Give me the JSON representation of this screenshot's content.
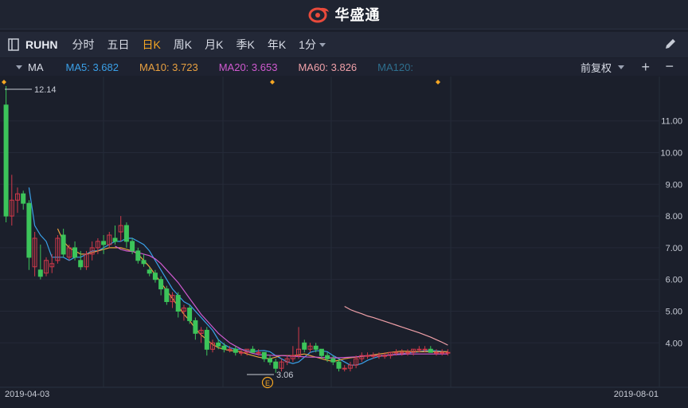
{
  "app": {
    "brand": "华盛通"
  },
  "toolbar": {
    "symbol": "RUHN",
    "periods": [
      "分时",
      "五日",
      "日K",
      "周K",
      "月K",
      "季K",
      "年K"
    ],
    "active_period": "日K",
    "minute_select": "1分"
  },
  "ma_legend": {
    "name": "MA",
    "items": [
      {
        "label": "MA5: 3.682",
        "color": "#3aa0e8"
      },
      {
        "label": "MA10: 3.723",
        "color": "#e8a040"
      },
      {
        "label": "MA20: 3.653",
        "color": "#d05ad0"
      },
      {
        "label": "MA60: 3.826",
        "color": "#f0a0a8"
      },
      {
        "label": "MA120:",
        "color": "#2e6f8e"
      }
    ],
    "adjust": "前复权"
  },
  "colors": {
    "up": "#d0394a",
    "down": "#3cc45a",
    "grid": "#2a3040",
    "bg": "#1b1f2b"
  },
  "chart_data": {
    "type": "candlestick",
    "x_start_label": "2019-04-03",
    "x_end_label": "2019-08-01",
    "ylim": [
      2.6,
      12.4
    ],
    "yticks": [
      "11.00",
      "10.00",
      "9.00",
      "8.00",
      "7.00",
      "6.00",
      "5.00",
      "4.00"
    ],
    "high_label": "12.14",
    "low_label": "3.06",
    "event_badge": "E",
    "ohlc": [
      [
        11.5,
        12.1,
        7.8,
        8.0
      ],
      [
        8.0,
        9.3,
        7.7,
        8.5
      ],
      [
        8.5,
        8.9,
        8.1,
        8.7
      ],
      [
        8.7,
        8.8,
        8.2,
        8.4
      ],
      [
        8.4,
        8.5,
        6.3,
        6.7
      ],
      [
        6.4,
        7.5,
        6.1,
        7.3
      ],
      [
        6.3,
        7.1,
        6.0,
        6.1
      ],
      [
        6.2,
        6.7,
        6.1,
        6.6
      ],
      [
        6.4,
        6.8,
        6.2,
        6.5
      ],
      [
        6.6,
        7.4,
        6.5,
        7.3
      ],
      [
        7.4,
        7.6,
        6.7,
        6.8
      ],
      [
        6.7,
        7.1,
        6.6,
        7.0
      ],
      [
        7.0,
        7.2,
        6.6,
        6.7
      ],
      [
        6.6,
        6.9,
        6.3,
        6.4
      ],
      [
        6.4,
        6.9,
        6.3,
        6.8
      ],
      [
        6.8,
        7.2,
        6.6,
        7.0
      ],
      [
        7.0,
        7.3,
        6.8,
        7.2
      ],
      [
        7.2,
        7.4,
        6.8,
        7.1
      ],
      [
        7.1,
        7.5,
        7.0,
        7.4
      ],
      [
        7.3,
        7.7,
        7.1,
        7.2
      ],
      [
        7.5,
        8.0,
        7.2,
        7.7
      ],
      [
        7.7,
        7.8,
        7.0,
        7.2
      ],
      [
        7.2,
        7.3,
        6.8,
        6.9
      ],
      [
        6.9,
        7.0,
        6.5,
        6.6
      ],
      [
        6.6,
        6.8,
        6.4,
        6.5
      ],
      [
        6.3,
        6.4,
        6.1,
        6.2
      ],
      [
        6.2,
        6.3,
        5.9,
        6.0
      ],
      [
        6.0,
        6.1,
        5.5,
        5.7
      ],
      [
        5.7,
        5.8,
        5.2,
        5.3
      ],
      [
        5.3,
        5.6,
        5.1,
        5.5
      ],
      [
        5.5,
        5.6,
        4.8,
        5.0
      ],
      [
        5.0,
        5.2,
        4.7,
        5.1
      ],
      [
        5.1,
        5.2,
        4.6,
        4.7
      ],
      [
        4.7,
        4.8,
        4.1,
        4.3
      ],
      [
        4.3,
        4.5,
        4.0,
        4.4
      ],
      [
        4.4,
        4.5,
        3.6,
        3.8
      ],
      [
        3.8,
        4.1,
        3.7,
        4.0
      ],
      [
        4.0,
        4.1,
        3.8,
        3.9
      ],
      [
        3.9,
        4.0,
        3.7,
        3.8
      ],
      [
        3.8,
        3.9,
        3.7,
        3.8
      ],
      [
        3.8,
        3.9,
        3.6,
        3.7
      ],
      [
        3.7,
        3.8,
        3.6,
        3.7
      ],
      [
        3.7,
        3.8,
        3.6,
        3.8
      ],
      [
        3.8,
        3.9,
        3.7,
        3.7
      ],
      [
        3.7,
        3.8,
        3.6,
        3.7
      ],
      [
        3.7,
        3.7,
        3.4,
        3.5
      ],
      [
        3.5,
        3.6,
        3.3,
        3.4
      ],
      [
        3.4,
        3.5,
        3.06,
        3.2
      ],
      [
        3.2,
        3.5,
        3.1,
        3.4
      ],
      [
        3.4,
        3.6,
        3.3,
        3.5
      ],
      [
        3.5,
        3.9,
        3.4,
        3.6
      ],
      [
        3.6,
        4.5,
        3.5,
        3.8
      ],
      [
        4.0,
        4.1,
        3.7,
        3.8
      ],
      [
        3.8,
        4.0,
        3.7,
        3.9
      ],
      [
        3.9,
        4.0,
        3.7,
        3.8
      ],
      [
        3.8,
        3.8,
        3.5,
        3.6
      ],
      [
        3.6,
        3.7,
        3.4,
        3.5
      ],
      [
        3.5,
        3.6,
        3.3,
        3.4
      ],
      [
        3.4,
        3.5,
        3.1,
        3.2
      ],
      [
        3.2,
        3.3,
        3.1,
        3.2
      ],
      [
        3.2,
        3.4,
        3.1,
        3.3
      ],
      [
        3.3,
        3.6,
        3.2,
        3.5
      ],
      [
        3.5,
        3.7,
        3.4,
        3.6
      ],
      [
        3.6,
        3.7,
        3.5,
        3.6
      ],
      [
        3.6,
        3.7,
        3.5,
        3.6
      ],
      [
        3.6,
        3.7,
        3.5,
        3.6
      ],
      [
        3.6,
        3.7,
        3.5,
        3.6
      ],
      [
        3.6,
        3.7,
        3.5,
        3.7
      ],
      [
        3.7,
        3.8,
        3.6,
        3.7
      ],
      [
        3.7,
        3.8,
        3.6,
        3.7
      ],
      [
        3.7,
        3.8,
        3.6,
        3.7
      ],
      [
        3.7,
        3.8,
        3.6,
        3.8
      ],
      [
        3.8,
        3.9,
        3.7,
        3.8
      ],
      [
        3.8,
        3.9,
        3.7,
        3.8
      ],
      [
        3.8,
        3.9,
        3.7,
        3.7
      ],
      [
        3.7,
        3.8,
        3.6,
        3.7
      ],
      [
        3.7,
        3.8,
        3.6,
        3.7
      ],
      [
        3.7,
        3.8,
        3.6,
        3.7
      ]
    ],
    "ma_series": [
      {
        "name": "MA5",
        "color": "#3aa0e8",
        "start": 4,
        "values": [
          8.9,
          7.7,
          7.4,
          7.2,
          6.7,
          6.7,
          6.7,
          6.6,
          6.7,
          6.7,
          6.8,
          6.9,
          6.9,
          7.0,
          7.1,
          7.2,
          7.2,
          7.3,
          7.3,
          7.2,
          7.1,
          6.9,
          6.6,
          6.3,
          6.0,
          5.7,
          5.5,
          5.3,
          5.2,
          5.0,
          4.8,
          4.6,
          4.4,
          4.1,
          3.95,
          3.85,
          3.8,
          3.8,
          3.75,
          3.72,
          3.75,
          3.76,
          3.72,
          3.6,
          3.5,
          3.4,
          3.35,
          3.4,
          3.55,
          3.7,
          3.75,
          3.75,
          3.72,
          3.6,
          3.5,
          3.4,
          3.3,
          3.3,
          3.35,
          3.45,
          3.52,
          3.57,
          3.6,
          3.62,
          3.64,
          3.66,
          3.68,
          3.7,
          3.72,
          3.75,
          3.76,
          3.75,
          3.73,
          3.72
        ]
      },
      {
        "name": "MA10",
        "color": "#e8a040",
        "start": 9,
        "values": [
          7.6,
          7.2,
          7.0,
          6.9,
          6.8,
          6.8,
          6.85,
          6.9,
          6.95,
          7.0,
          7.0,
          7.0,
          6.95,
          6.9,
          6.8,
          6.6,
          6.4,
          6.15,
          5.9,
          5.65,
          5.4,
          5.15,
          4.9,
          4.7,
          4.45,
          4.25,
          4.1,
          3.95,
          3.85,
          3.8,
          3.75,
          3.75,
          3.72,
          3.65,
          3.6,
          3.55,
          3.52,
          3.5,
          3.55,
          3.6,
          3.6,
          3.6,
          3.62,
          3.65,
          3.6,
          3.55,
          3.5,
          3.45,
          3.42,
          3.45,
          3.5,
          3.53,
          3.55,
          3.57,
          3.6,
          3.62,
          3.65,
          3.67,
          3.7,
          3.72,
          3.74,
          3.73,
          3.73,
          3.72,
          3.72,
          3.72,
          3.72,
          3.72,
          3.72
        ]
      },
      {
        "name": "MA20",
        "color": "#d05ad0",
        "start": 19,
        "values": [
          7.05,
          6.95,
          6.9,
          6.88,
          6.85,
          6.8,
          6.75,
          6.65,
          6.5,
          6.3,
          6.1,
          5.9,
          5.65,
          5.4,
          5.15,
          4.9,
          4.7,
          4.5,
          4.3,
          4.15,
          4.0,
          3.9,
          3.8,
          3.72,
          3.67,
          3.63,
          3.62,
          3.61,
          3.6,
          3.6,
          3.59,
          3.58,
          3.57,
          3.56,
          3.55,
          3.55,
          3.54,
          3.53,
          3.53,
          3.53,
          3.54,
          3.55,
          3.56,
          3.58,
          3.6,
          3.6,
          3.6,
          3.61,
          3.62,
          3.63,
          3.64,
          3.65,
          3.65,
          3.65,
          3.65,
          3.65,
          3.65,
          3.65,
          3.65
        ]
      },
      {
        "name": "MA60",
        "color": "#f0a0a8",
        "start": 59,
        "values": [
          5.15,
          5.05,
          4.98,
          4.92,
          4.85,
          4.8,
          4.74,
          4.68,
          4.62,
          4.56,
          4.5,
          4.44,
          4.38,
          4.32,
          4.25,
          4.18,
          4.1,
          4.02,
          3.93
        ]
      }
    ]
  }
}
